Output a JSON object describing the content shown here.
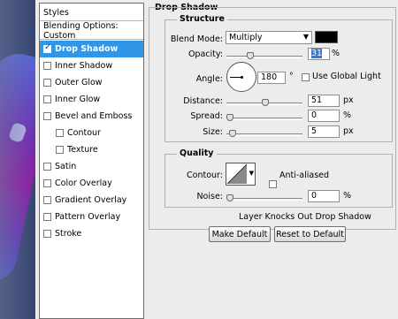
{
  "style_list": {
    "header": "Styles",
    "blending": "Blending Options: Custom",
    "items": [
      {
        "label": "Drop Shadow",
        "checked": true,
        "selected": true,
        "sub": false
      },
      {
        "label": "Inner Shadow",
        "checked": false,
        "selected": false,
        "sub": false
      },
      {
        "label": "Outer Glow",
        "checked": false,
        "selected": false,
        "sub": false
      },
      {
        "label": "Inner Glow",
        "checked": false,
        "selected": false,
        "sub": false
      },
      {
        "label": "Bevel and Emboss",
        "checked": false,
        "selected": false,
        "sub": false
      },
      {
        "label": "Contour",
        "checked": false,
        "selected": false,
        "sub": true
      },
      {
        "label": "Texture",
        "checked": false,
        "selected": false,
        "sub": true
      },
      {
        "label": "Satin",
        "checked": false,
        "selected": false,
        "sub": false
      },
      {
        "label": "Color Overlay",
        "checked": false,
        "selected": false,
        "sub": false
      },
      {
        "label": "Gradient Overlay",
        "checked": false,
        "selected": false,
        "sub": false
      },
      {
        "label": "Pattern Overlay",
        "checked": false,
        "selected": false,
        "sub": false
      },
      {
        "label": "Stroke",
        "checked": false,
        "selected": false,
        "sub": false
      }
    ]
  },
  "panel": {
    "title": "Drop Shadow",
    "structure": {
      "legend": "Structure",
      "blend_mode_label": "Blend Mode:",
      "blend_mode_value": "Multiply",
      "shadow_color": "#000000",
      "opacity_label": "Opacity:",
      "opacity_value": "31",
      "opacity_unit": "%",
      "angle_label": "Angle:",
      "angle_value": "180",
      "angle_unit": "°",
      "global_light_label": "Use Global Light",
      "distance_label": "Distance:",
      "distance_value": "51",
      "distance_unit": "px",
      "spread_label": "Spread:",
      "spread_value": "0",
      "spread_unit": "%",
      "size_label": "Size:",
      "size_value": "5",
      "size_unit": "px"
    },
    "quality": {
      "legend": "Quality",
      "contour_label": "Contour:",
      "anti_aliased_label": "Anti-aliased",
      "noise_label": "Noise:",
      "noise_value": "0",
      "noise_unit": "%"
    },
    "knockout_label": "Layer Knocks Out Drop Shadow",
    "knockout_checked": true,
    "make_default_label": "Make Default",
    "reset_default_label": "Reset to Default"
  },
  "colors": {
    "selection": "#3296e6",
    "shadow_swatch": "#000000"
  }
}
